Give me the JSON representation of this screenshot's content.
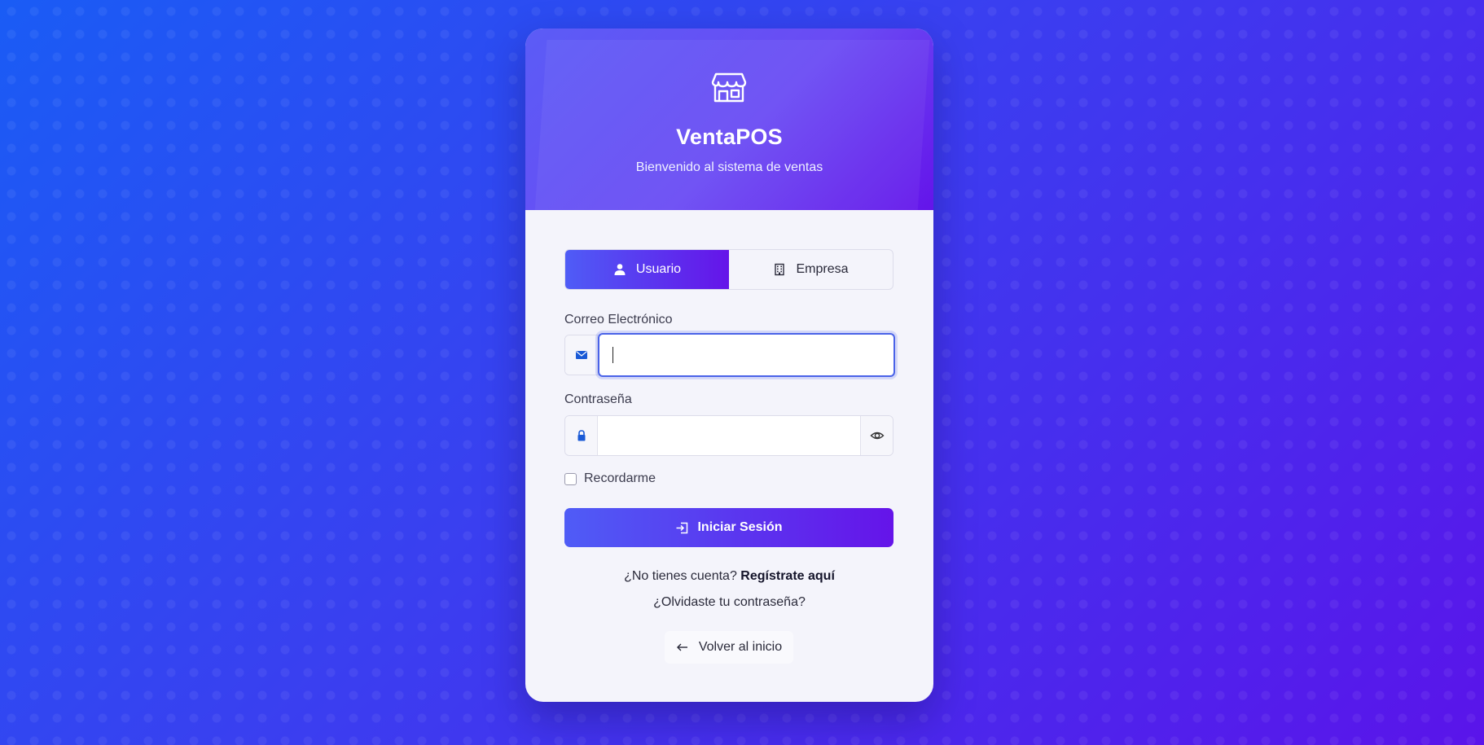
{
  "brand": {
    "name": "VentaPOS",
    "tagline": "Bienvenido al sistema de ventas"
  },
  "tabs": [
    {
      "label": "Usuario",
      "icon": "user-icon",
      "active": true
    },
    {
      "label": "Empresa",
      "icon": "building-icon",
      "active": false
    }
  ],
  "form": {
    "email_label": "Correo Electrónico",
    "email_value": "",
    "password_label": "Contraseña",
    "password_value": "",
    "remember_label": "Recordarme",
    "remember_checked": false,
    "submit_label": "Iniciar Sesión"
  },
  "links": {
    "register_prefix": "¿No tienes cuenta?",
    "register_link": "Regístrate aquí",
    "forgot": "¿Olvidaste tu contraseña?",
    "back": "Volver al inicio"
  },
  "colors": {
    "accent_start": "#4f5cf6",
    "accent_end": "#6514e9",
    "focus_border": "#4a63e8",
    "input_icon": "#1a5ad6"
  }
}
